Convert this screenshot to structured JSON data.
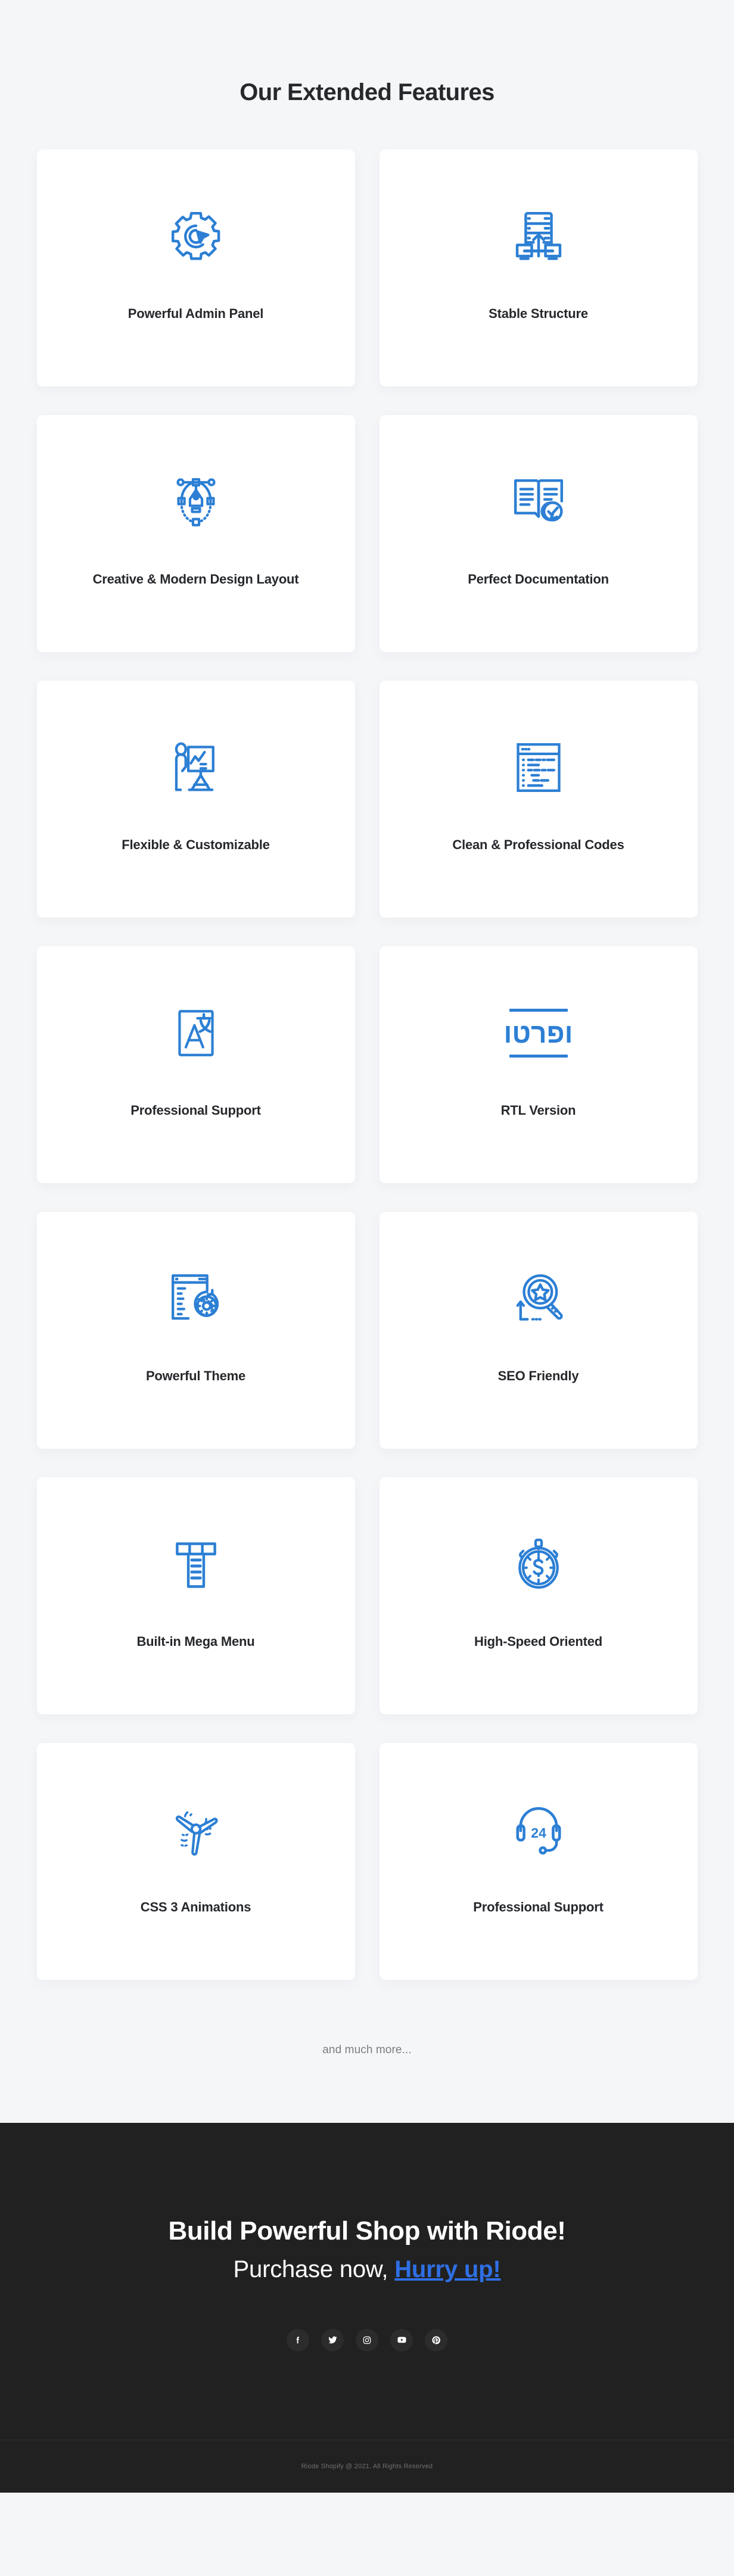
{
  "section": {
    "title": "Our Extended Features",
    "much_more": "and much more..."
  },
  "colors": {
    "accent_blue": "#2c7fd4",
    "cta_link_blue": "#2f6fe4",
    "page_background": "#f5f6f8",
    "card_background": "#ffffff",
    "footer_background": "#212121",
    "heading_text": "#26282c"
  },
  "features": [
    {
      "title": "Powerful Admin Panel",
      "icon": "gear-cursor-icon"
    },
    {
      "title": "Stable Structure",
      "icon": "server-network-icon"
    },
    {
      "title": "Creative & Modern Design Layout",
      "icon": "pen-tool-icon"
    },
    {
      "title": "Perfect Documentation",
      "icon": "book-check-icon"
    },
    {
      "title": "Flexible & Customizable",
      "icon": "presentation-person-icon"
    },
    {
      "title": "Clean & Professional Codes",
      "icon": "code-window-icon"
    },
    {
      "title": "Professional Support",
      "icon": "translate-icon"
    },
    {
      "title": "RTL Version",
      "icon": "rtl-text-icon",
      "glyph": "ופרטו"
    },
    {
      "title": "Powerful Theme",
      "icon": "browser-gear-icon"
    },
    {
      "title": "SEO Friendly",
      "icon": "magnifier-star-icon"
    },
    {
      "title": "Built-in Mega Menu",
      "icon": "mega-menu-icon"
    },
    {
      "title": "High-Speed Oriented",
      "icon": "stopwatch-dollar-icon"
    },
    {
      "title": "CSS 3 Animations",
      "icon": "propeller-fan-icon"
    },
    {
      "title": "Professional Support",
      "icon": "headset-24-icon",
      "badge": "24"
    }
  ],
  "cta": {
    "heading": "Build Powerful Shop with Riode!",
    "sub_prefix": "Purchase now, ",
    "sub_highlight": "Hurry up!"
  },
  "social": [
    {
      "name": "facebook",
      "label": "Facebook"
    },
    {
      "name": "twitter",
      "label": "Twitter"
    },
    {
      "name": "instagram",
      "label": "Instagram"
    },
    {
      "name": "youtube",
      "label": "YouTube"
    },
    {
      "name": "pinterest",
      "label": "Pinterest"
    }
  ],
  "footer": {
    "copyright": "Riode Shopify @ 2021. All Rights Reserved"
  }
}
